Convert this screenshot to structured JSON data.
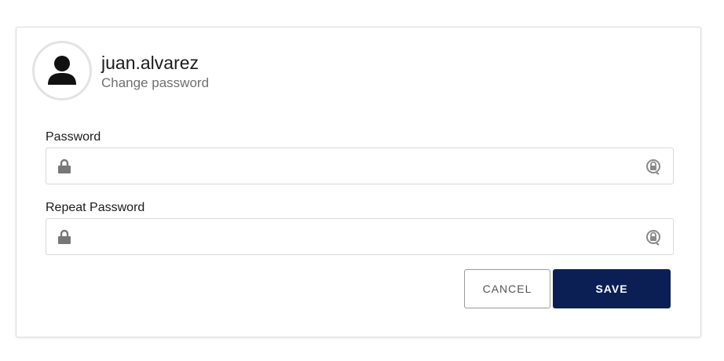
{
  "user": {
    "username": "juan.alvarez",
    "subtitle": "Change password"
  },
  "form": {
    "password_label": "Password",
    "password_value": "",
    "repeat_password_label": "Repeat Password",
    "repeat_password_value": ""
  },
  "actions": {
    "cancel_label": "CANCEL",
    "save_label": "SAVE"
  },
  "icons": {
    "avatar": "user-icon",
    "field_left": "lock-icon",
    "field_right": "reveal-password-icon"
  },
  "colors": {
    "save_background": "#0b1f54",
    "card_border": "#dcdcdc"
  }
}
